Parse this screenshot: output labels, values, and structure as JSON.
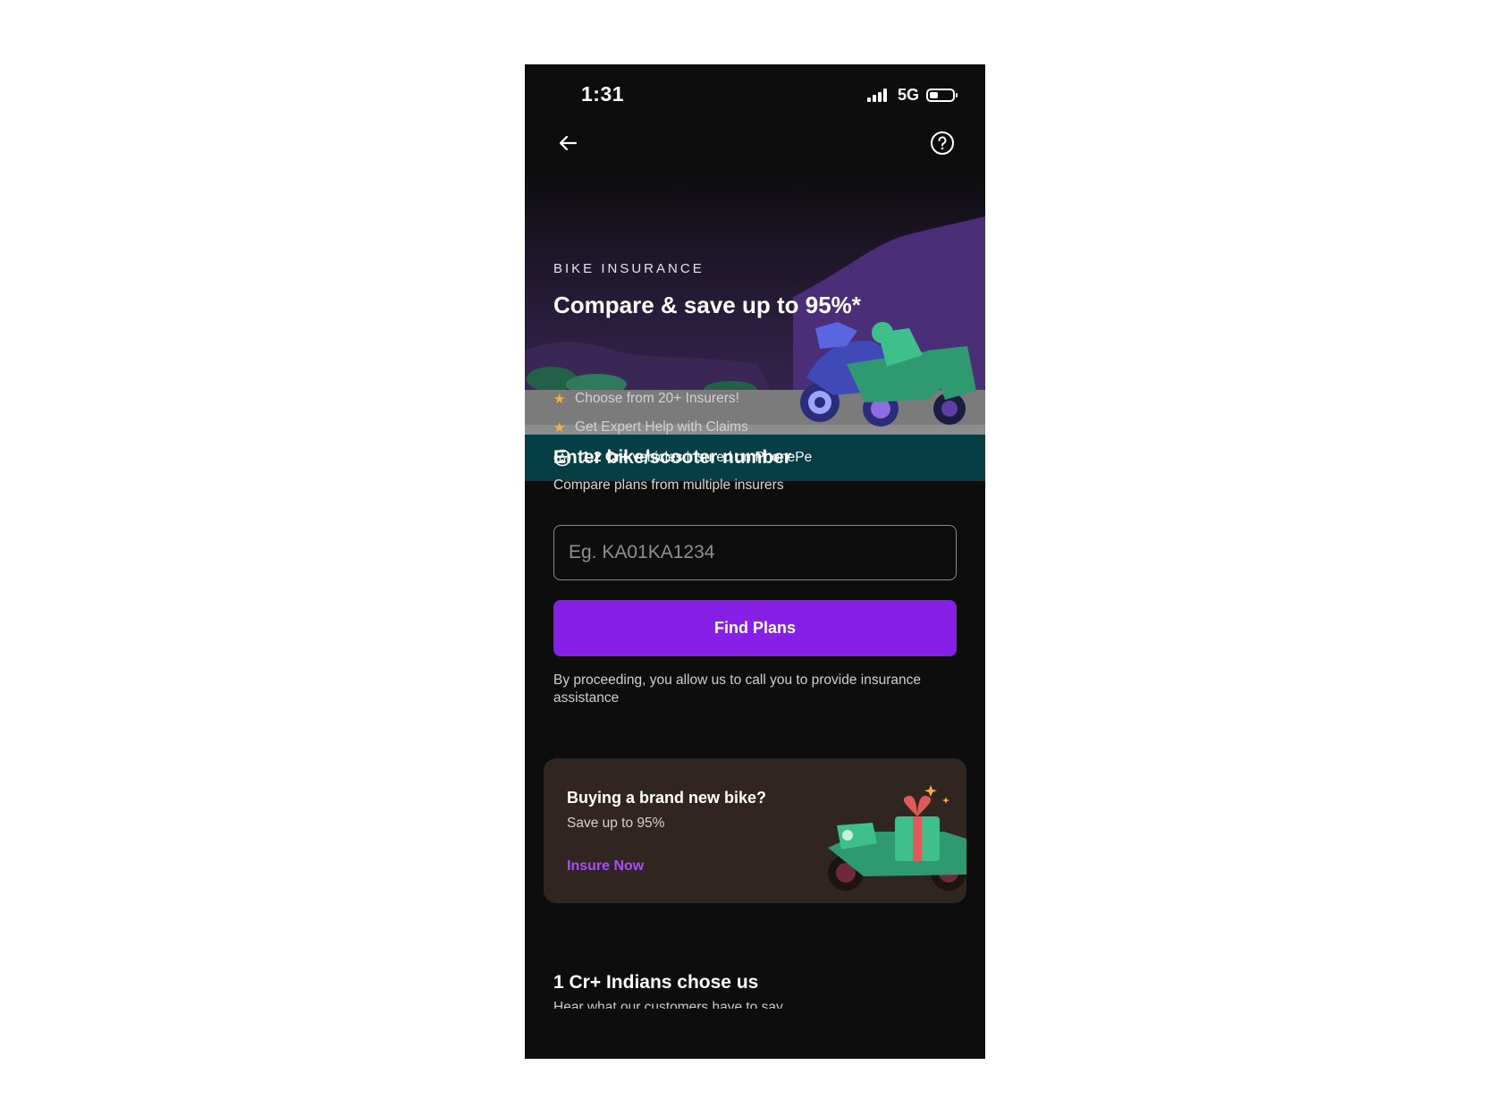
{
  "status_bar": {
    "time": "1:31",
    "network": "5G",
    "battery_level": 0.45
  },
  "nav": {
    "back_icon": "arrow-left-icon",
    "help_icon": "question-circle-icon"
  },
  "hero": {
    "eyebrow": "BIKE INSURANCE",
    "title": "Compare & save up to 95%*",
    "bullets": [
      "Choose from 20+ Insurers!",
      "Get Expert Help with Claims"
    ],
    "banner_bold": "1.2 Cr+",
    "banner_text": " vehicles insured on PhonePe",
    "banner_icon": "star-badge-icon"
  },
  "form": {
    "title": "Enter bike/scooter number",
    "subtitle": "Compare plans from multiple insurers",
    "input_placeholder": "Eg. KA01KA1234",
    "input_value": "",
    "button_label": "Find Plans",
    "consent": "By proceeding, you allow us to call you to provide insurance assistance"
  },
  "promo": {
    "title": "Buying a brand new bike?",
    "subtitle": "Save up to 95%",
    "cta": "Insure Now"
  },
  "social": {
    "title": "1 Cr+ Indians chose us",
    "subtitle": "Hear what our customers have to say"
  },
  "colors": {
    "background": "#0d0d0d",
    "accent": "#8620e6",
    "banner": "#053e45",
    "promo_card": "#302520",
    "promo_cta": "#a650f5",
    "star": "#f5b53a"
  }
}
